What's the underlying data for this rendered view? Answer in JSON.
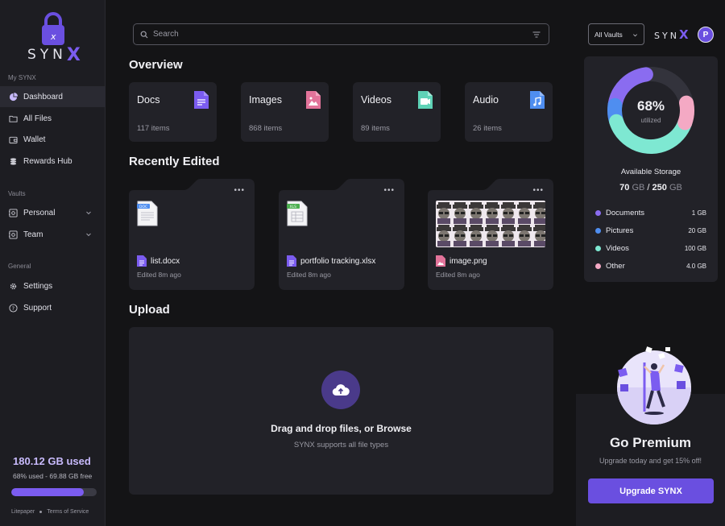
{
  "brand": {
    "name": "SYN",
    "accent_letter": "X",
    "accent": "#7b5cf0"
  },
  "sidebar": {
    "section_my": "My SYNX",
    "items_my": [
      {
        "label": "Dashboard",
        "icon": "pie-chart-icon",
        "active": true
      },
      {
        "label": "All Files",
        "icon": "folder-icon"
      },
      {
        "label": "Wallet",
        "icon": "wallet-icon"
      },
      {
        "label": "Rewards Hub",
        "icon": "coins-icon"
      }
    ],
    "section_vaults": "Vaults",
    "items_vaults": [
      {
        "label": "Personal",
        "icon": "vault-icon"
      },
      {
        "label": "Team",
        "icon": "vault-icon"
      }
    ],
    "section_general": "General",
    "items_general": [
      {
        "label": "Settings",
        "icon": "gear-icon"
      },
      {
        "label": "Support",
        "icon": "help-icon"
      }
    ],
    "usage": {
      "title": "180.12 GB used",
      "subtitle": "68% used - 69.88 GB free",
      "fraction": 0.85
    },
    "footer": {
      "litepaper": "Litepaper",
      "terms": "Terms of Service"
    }
  },
  "main": {
    "search_placeholder": "Search",
    "overview_title": "Overview",
    "overview": [
      {
        "title": "Docs",
        "count": "117 items",
        "color": "#7b5cf0"
      },
      {
        "title": "Images",
        "count": "868 items",
        "color": "#e2739a"
      },
      {
        "title": "Videos",
        "count": "89 items",
        "color": "#5fd3b7"
      },
      {
        "title": "Audio",
        "count": "26 items",
        "color": "#4f8ef0"
      }
    ],
    "recent_title": "Recently Edited",
    "recent": [
      {
        "name": "list.docx",
        "edited": "Edited 8m ago",
        "badge": "DOC",
        "badge_color": "#4f8ef0"
      },
      {
        "name": "portfolio tracking.xlsx",
        "edited": "Edited 8m ago",
        "badge": "XLS",
        "badge_color": "#4caf50"
      },
      {
        "name": "image.png",
        "edited": "Edited 8m ago"
      }
    ],
    "upload_title": "Upload",
    "upload_main": "Drag and drop files, or Browse",
    "upload_sub": "SYNX supports all file types"
  },
  "right": {
    "vault_select": "All Vaults",
    "avatar": "P",
    "storage": {
      "percent": "68%",
      "percent_label": "utilized",
      "available_label": "Available Storage",
      "used": "70",
      "total": "250",
      "unit": "GB",
      "legend": [
        {
          "label": "Documents",
          "value": "1 GB",
          "color": "#8a6cf0"
        },
        {
          "label": "Pictures",
          "value": "20 GB",
          "color": "#4f8ef0"
        },
        {
          "label": "Videos",
          "value": "100 GB",
          "color": "#7ee8d2"
        },
        {
          "label": "Other",
          "value": "4.0 GB",
          "color": "#f4a9c4"
        }
      ]
    },
    "premium": {
      "title": "Go Premium",
      "subtitle": "Upgrade today and get 15% off!",
      "button": "Upgrade SYNX"
    }
  }
}
